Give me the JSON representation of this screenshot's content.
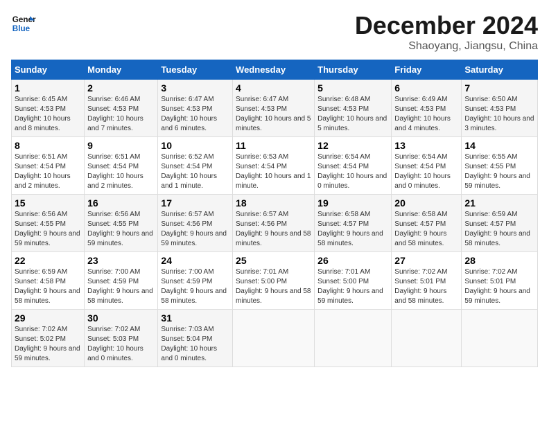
{
  "logo": {
    "line1": "General",
    "line2": "Blue"
  },
  "title": "December 2024",
  "location": "Shaoyang, Jiangsu, China",
  "days_of_week": [
    "Sunday",
    "Monday",
    "Tuesday",
    "Wednesday",
    "Thursday",
    "Friday",
    "Saturday"
  ],
  "weeks": [
    [
      {
        "day": "1",
        "sunrise": "6:45 AM",
        "sunset": "4:53 PM",
        "daylight": "10 hours and 8 minutes."
      },
      {
        "day": "2",
        "sunrise": "6:46 AM",
        "sunset": "4:53 PM",
        "daylight": "10 hours and 7 minutes."
      },
      {
        "day": "3",
        "sunrise": "6:47 AM",
        "sunset": "4:53 PM",
        "daylight": "10 hours and 6 minutes."
      },
      {
        "day": "4",
        "sunrise": "6:47 AM",
        "sunset": "4:53 PM",
        "daylight": "10 hours and 5 minutes."
      },
      {
        "day": "5",
        "sunrise": "6:48 AM",
        "sunset": "4:53 PM",
        "daylight": "10 hours and 5 minutes."
      },
      {
        "day": "6",
        "sunrise": "6:49 AM",
        "sunset": "4:53 PM",
        "daylight": "10 hours and 4 minutes."
      },
      {
        "day": "7",
        "sunrise": "6:50 AM",
        "sunset": "4:53 PM",
        "daylight": "10 hours and 3 minutes."
      }
    ],
    [
      {
        "day": "8",
        "sunrise": "6:51 AM",
        "sunset": "4:54 PM",
        "daylight": "10 hours and 2 minutes."
      },
      {
        "day": "9",
        "sunrise": "6:51 AM",
        "sunset": "4:54 PM",
        "daylight": "10 hours and 2 minutes."
      },
      {
        "day": "10",
        "sunrise": "6:52 AM",
        "sunset": "4:54 PM",
        "daylight": "10 hours and 1 minute."
      },
      {
        "day": "11",
        "sunrise": "6:53 AM",
        "sunset": "4:54 PM",
        "daylight": "10 hours and 1 minute."
      },
      {
        "day": "12",
        "sunrise": "6:54 AM",
        "sunset": "4:54 PM",
        "daylight": "10 hours and 0 minutes."
      },
      {
        "day": "13",
        "sunrise": "6:54 AM",
        "sunset": "4:54 PM",
        "daylight": "10 hours and 0 minutes."
      },
      {
        "day": "14",
        "sunrise": "6:55 AM",
        "sunset": "4:55 PM",
        "daylight": "9 hours and 59 minutes."
      }
    ],
    [
      {
        "day": "15",
        "sunrise": "6:56 AM",
        "sunset": "4:55 PM",
        "daylight": "9 hours and 59 minutes."
      },
      {
        "day": "16",
        "sunrise": "6:56 AM",
        "sunset": "4:55 PM",
        "daylight": "9 hours and 59 minutes."
      },
      {
        "day": "17",
        "sunrise": "6:57 AM",
        "sunset": "4:56 PM",
        "daylight": "9 hours and 59 minutes."
      },
      {
        "day": "18",
        "sunrise": "6:57 AM",
        "sunset": "4:56 PM",
        "daylight": "9 hours and 58 minutes."
      },
      {
        "day": "19",
        "sunrise": "6:58 AM",
        "sunset": "4:57 PM",
        "daylight": "9 hours and 58 minutes."
      },
      {
        "day": "20",
        "sunrise": "6:58 AM",
        "sunset": "4:57 PM",
        "daylight": "9 hours and 58 minutes."
      },
      {
        "day": "21",
        "sunrise": "6:59 AM",
        "sunset": "4:57 PM",
        "daylight": "9 hours and 58 minutes."
      }
    ],
    [
      {
        "day": "22",
        "sunrise": "6:59 AM",
        "sunset": "4:58 PM",
        "daylight": "9 hours and 58 minutes."
      },
      {
        "day": "23",
        "sunrise": "7:00 AM",
        "sunset": "4:59 PM",
        "daylight": "9 hours and 58 minutes."
      },
      {
        "day": "24",
        "sunrise": "7:00 AM",
        "sunset": "4:59 PM",
        "daylight": "9 hours and 58 minutes."
      },
      {
        "day": "25",
        "sunrise": "7:01 AM",
        "sunset": "5:00 PM",
        "daylight": "9 hours and 58 minutes."
      },
      {
        "day": "26",
        "sunrise": "7:01 AM",
        "sunset": "5:00 PM",
        "daylight": "9 hours and 59 minutes."
      },
      {
        "day": "27",
        "sunrise": "7:02 AM",
        "sunset": "5:01 PM",
        "daylight": "9 hours and 58 minutes."
      },
      {
        "day": "28",
        "sunrise": "7:02 AM",
        "sunset": "5:01 PM",
        "daylight": "9 hours and 59 minutes."
      }
    ],
    [
      {
        "day": "29",
        "sunrise": "7:02 AM",
        "sunset": "5:02 PM",
        "daylight": "9 hours and 59 minutes."
      },
      {
        "day": "30",
        "sunrise": "7:02 AM",
        "sunset": "5:03 PM",
        "daylight": "10 hours and 0 minutes."
      },
      {
        "day": "31",
        "sunrise": "7:03 AM",
        "sunset": "5:04 PM",
        "daylight": "10 hours and 0 minutes."
      },
      null,
      null,
      null,
      null
    ]
  ]
}
